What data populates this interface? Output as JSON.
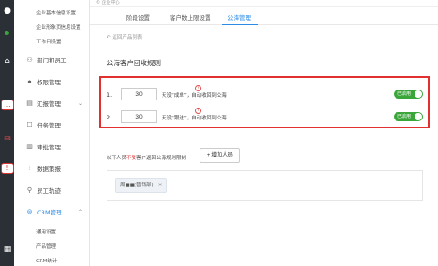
{
  "topbar": {
    "title": "© 企业中心"
  },
  "sidebar": {
    "sub_items": [
      "企业基本信息设置",
      "企业形象页信息设置",
      "工作日设置"
    ],
    "nav": [
      {
        "label": "部门和员工",
        "icon": "org-icon"
      },
      {
        "label": "权限管理",
        "icon": "lock-icon"
      },
      {
        "label": "汇报管理",
        "icon": "report-icon"
      },
      {
        "label": "任务管理",
        "icon": "task-icon"
      },
      {
        "label": "审批管理",
        "icon": "approval-icon"
      },
      {
        "label": "数据策报",
        "icon": "data-icon"
      },
      {
        "label": "员工轨迹",
        "icon": "track-icon"
      },
      {
        "label": "CRM管理",
        "icon": "crm-icon"
      }
    ],
    "crm_sub_items": [
      "通用设置",
      "产品管理",
      "CRM统计"
    ]
  },
  "tabs": [
    {
      "label": "阶段设置",
      "active": false
    },
    {
      "label": "客户数上限设置",
      "active": false
    },
    {
      "label": "公海管理",
      "active": true
    }
  ],
  "back_link": "返回产品列表",
  "section_title": "公海客户回收规则",
  "rules": [
    {
      "num": "1.",
      "days": "30",
      "text": "天没“成单”，自动收回到公海",
      "toggle": "已启用"
    },
    {
      "num": "2.",
      "days": "30",
      "text": "天没“跟进”，自动收回到公海",
      "toggle": "已启用"
    }
  ],
  "whitelist": {
    "label_prefix": "以下人员",
    "label_red": "不受",
    "label_suffix": "客户返回公海规则限制",
    "add_button": "+ 增加人员",
    "people": [
      {
        "name": "周■■(营销部)"
      }
    ]
  },
  "colors": {
    "accent": "#2b8ce6",
    "highlight_border": "#e03030",
    "toggle_on": "#3aa63a",
    "rail": "#2b2f36"
  }
}
